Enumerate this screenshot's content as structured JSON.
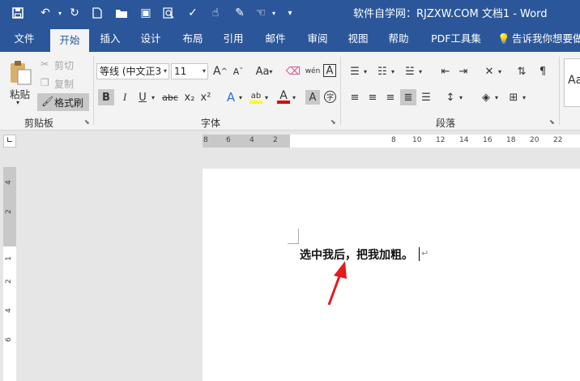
{
  "window": {
    "title": "软件自学网：RJZXW.COM 文档1 - Word"
  },
  "tabs": [
    {
      "label": "文件"
    },
    {
      "label": "开始",
      "active": true
    },
    {
      "label": "插入"
    },
    {
      "label": "设计"
    },
    {
      "label": "布局"
    },
    {
      "label": "引用"
    },
    {
      "label": "邮件"
    },
    {
      "label": "审阅"
    },
    {
      "label": "视图"
    },
    {
      "label": "帮助"
    },
    {
      "label": "PDF工具集"
    },
    {
      "label": "告诉我你想要做"
    }
  ],
  "clipboard": {
    "paste": "粘贴",
    "cut": "剪切",
    "copy": "复制",
    "format_painter": "格式刷",
    "group_label": "剪贴板"
  },
  "font": {
    "font_name": "等线 (中文正3",
    "font_size": "11",
    "group_label": "字体",
    "bold": "B",
    "italic": "I",
    "underline": "U",
    "strike": "abc",
    "subscript": "x₂",
    "superscript": "x²",
    "grow": "A",
    "shrink": "A",
    "case": "Aa",
    "phonetic": "wén",
    "char_border": "A",
    "char_shade": "A",
    "highlight": "ab",
    "font_color": "A",
    "enclose": "字"
  },
  "paragraph": {
    "group_label": "段落"
  },
  "styles": {
    "preview": "Aa"
  },
  "ruler": {
    "h_ticks": [
      "8",
      "6",
      "4",
      "2",
      "8",
      "10",
      "12",
      "14",
      "16",
      "18",
      "20",
      "22"
    ],
    "v_ticks": [
      "4",
      "2",
      "1",
      "2",
      "4",
      "6"
    ]
  },
  "document": {
    "text": "选中我后，把我加粗。",
    "para_mark": "↵"
  },
  "colors": {
    "brand": "#2b579a",
    "highlight": "#ffff00",
    "font_color": "#e00000",
    "arrow": "#e21c1c"
  }
}
